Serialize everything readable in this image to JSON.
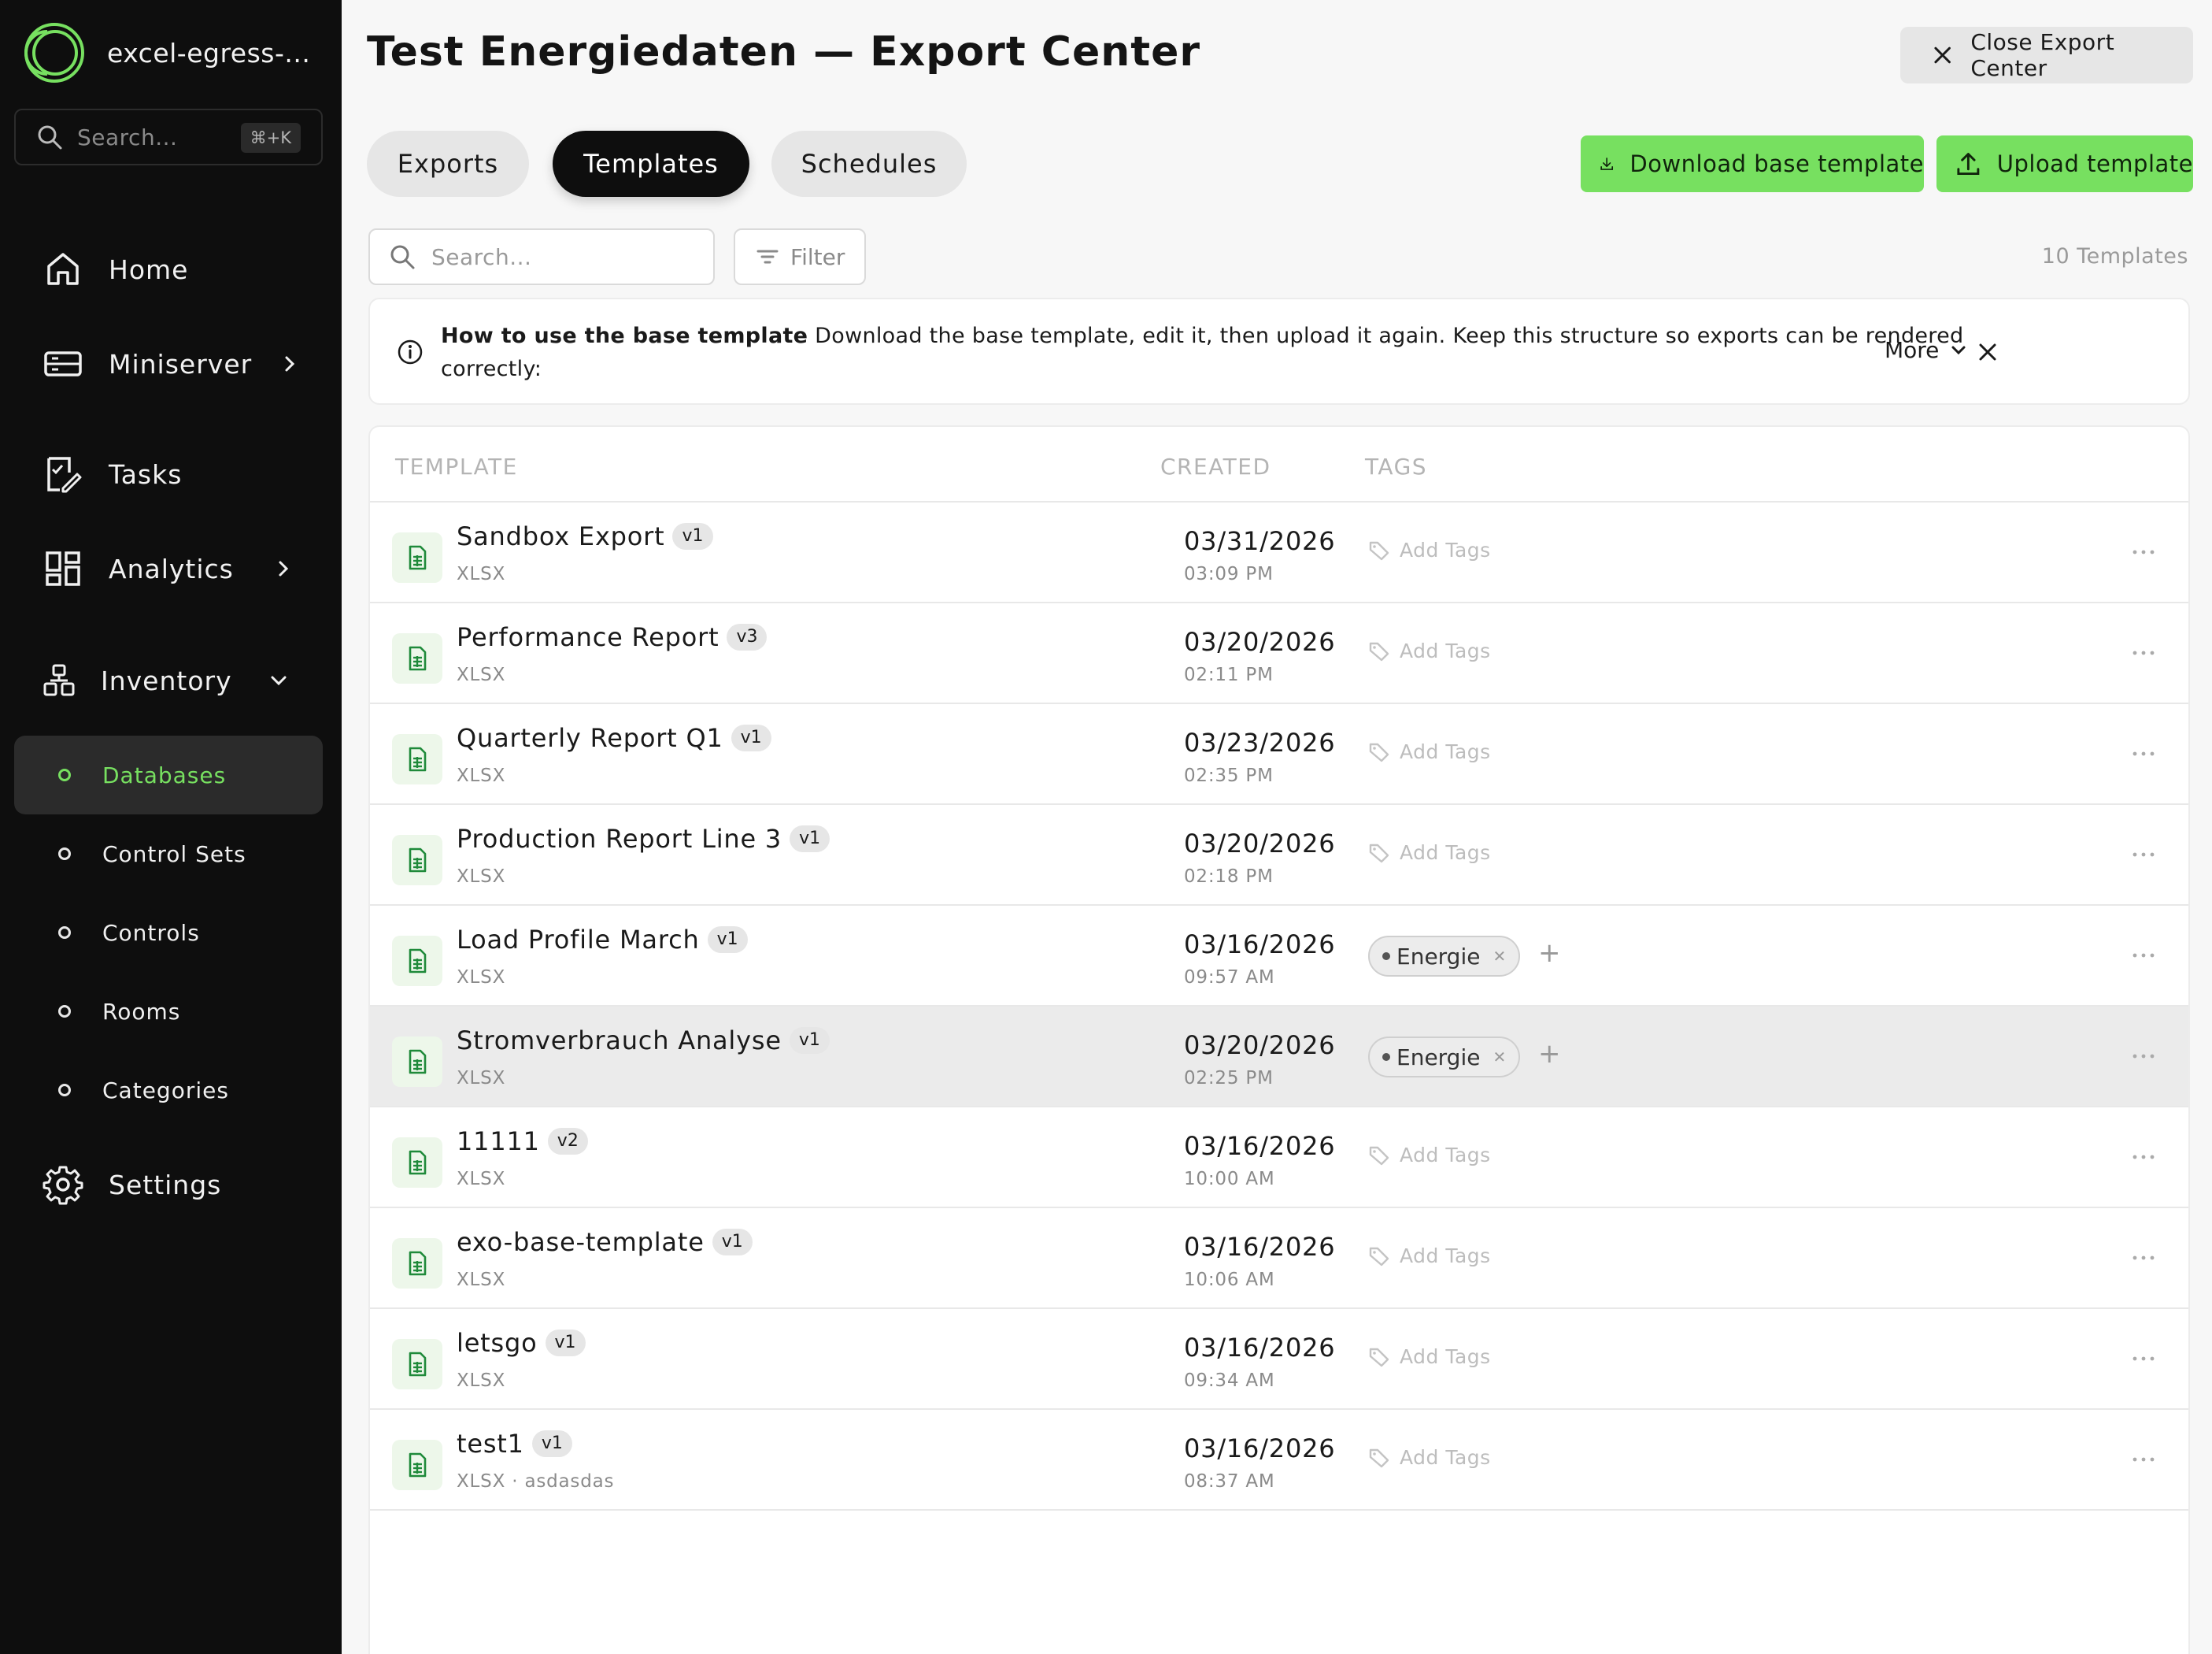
{
  "app": {
    "name": "excel-egress-...",
    "search_placeholder": "Search...",
    "search_shortcut": "⌘+K",
    "accent": "#77e060"
  },
  "sidebar": {
    "items": [
      {
        "label": "Home",
        "icon": "home-icon"
      },
      {
        "label": "Miniserver",
        "icon": "server-icon"
      },
      {
        "label": "Tasks",
        "icon": "tasks-icon"
      },
      {
        "label": "Analytics",
        "icon": "analytics-icon"
      },
      {
        "label": "Inventory",
        "icon": "inventory-icon"
      },
      {
        "label": "Settings",
        "icon": "gear-icon"
      }
    ],
    "inventory_children": [
      {
        "label": "Databases",
        "active": true
      },
      {
        "label": "Control Sets"
      },
      {
        "label": "Controls"
      },
      {
        "label": "Rooms"
      },
      {
        "label": "Categories"
      }
    ]
  },
  "header": {
    "title": "Test Energiedaten — Export Center",
    "close_label": "Close Export Center"
  },
  "tabs": [
    {
      "label": "Exports"
    },
    {
      "label": "Templates",
      "active": true
    },
    {
      "label": "Schedules"
    }
  ],
  "actions": {
    "download_label": "Download base template",
    "upload_label": "Upload template"
  },
  "toolbar": {
    "search_placeholder": "Search...",
    "filter_label": "Filter",
    "count_label": "10 Templates"
  },
  "info": {
    "bold": "How to use the base template",
    "text": " Download the base template, edit it, then upload it again. Keep this structure so exports can be rendered correctly:",
    "more_label": "More"
  },
  "table": {
    "columns": [
      "TEMPLATE",
      "CREATED",
      "TAGS"
    ],
    "add_tags_label": "Add Tags",
    "rows": [
      {
        "name": "Sandbox Export",
        "version": "v1",
        "format": "XLSX",
        "date": "03/31/2026",
        "time": "03:09 PM",
        "tags": []
      },
      {
        "name": "Performance Report",
        "version": "v3",
        "format": "XLSX",
        "date": "03/20/2026",
        "time": "02:11 PM",
        "tags": []
      },
      {
        "name": "Quarterly Report Q1",
        "version": "v1",
        "format": "XLSX",
        "date": "03/23/2026",
        "time": "02:35 PM",
        "tags": []
      },
      {
        "name": "Production Report Line 3",
        "version": "v1",
        "format": "XLSX",
        "date": "03/20/2026",
        "time": "02:18 PM",
        "tags": []
      },
      {
        "name": "Load Profile March",
        "version": "v1",
        "format": "XLSX",
        "date": "03/16/2026",
        "time": "09:57 AM",
        "tags": [
          "Energie"
        ]
      },
      {
        "name": "Stromverbrauch Analyse",
        "version": "v1",
        "format": "XLSX",
        "date": "03/20/2026",
        "time": "02:25 PM",
        "tags": [
          "Energie"
        ],
        "highlighted": true
      },
      {
        "name": "11111",
        "version": "v2",
        "format": "XLSX",
        "date": "03/16/2026",
        "time": "10:00 AM",
        "tags": []
      },
      {
        "name": "exo-base-template",
        "version": "v1",
        "format": "XLSX",
        "date": "03/16/2026",
        "time": "10:06 AM",
        "tags": []
      },
      {
        "name": "letsgo",
        "version": "v1",
        "format": "XLSX",
        "date": "03/16/2026",
        "time": "09:34 AM",
        "tags": []
      },
      {
        "name": "test1",
        "version": "v1",
        "format": "XLSX · asdasdas",
        "date": "03/16/2026",
        "time": "08:37 AM",
        "tags": []
      }
    ]
  }
}
